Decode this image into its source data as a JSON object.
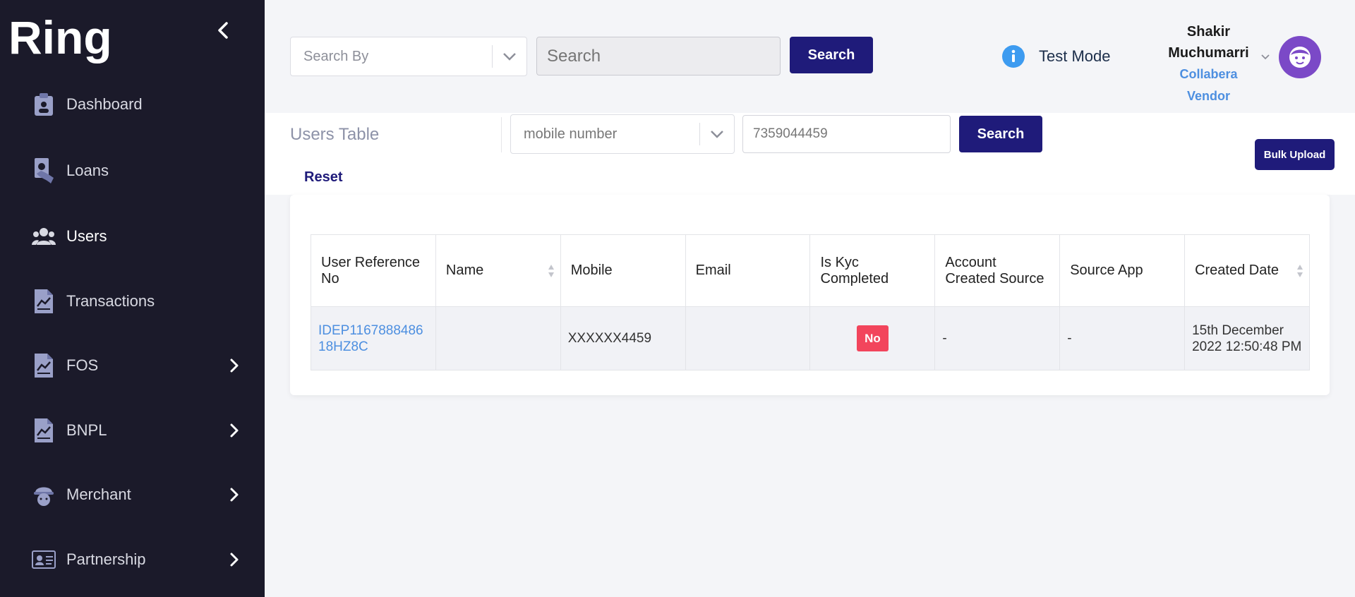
{
  "app": {
    "logo_text": "Ring"
  },
  "sidebar": {
    "items": [
      {
        "label": "Dashboard",
        "icon": "clipboard-icon",
        "has_submenu": false
      },
      {
        "label": "Loans",
        "icon": "money-hand-icon",
        "has_submenu": false
      },
      {
        "label": "Users",
        "icon": "users-icon",
        "has_submenu": false,
        "active": true
      },
      {
        "label": "Transactions",
        "icon": "chart-document-icon",
        "has_submenu": false
      },
      {
        "label": "FOS",
        "icon": "chart-document-icon",
        "has_submenu": true
      },
      {
        "label": "BNPL",
        "icon": "chart-document-icon",
        "has_submenu": true
      },
      {
        "label": "Merchant",
        "icon": "worker-helmet-icon",
        "has_submenu": true
      },
      {
        "label": "Partnership",
        "icon": "id-card-icon",
        "has_submenu": true
      }
    ]
  },
  "header": {
    "search_by": {
      "placeholder": "Search By"
    },
    "search": {
      "placeholder": "Search",
      "value": ""
    },
    "search_button": "Search",
    "test_mode": "Test Mode",
    "user": {
      "first_name": "Shakir",
      "last_name": "Muchumarri",
      "org": "Collabera",
      "role": "Vendor"
    }
  },
  "table_toolbar": {
    "title": "Users Table",
    "filter_field": "mobile number",
    "filter_value": "7359044459",
    "search_button": "Search",
    "bulk_upload_button": "Bulk Upload",
    "reset_label": "Reset"
  },
  "table": {
    "columns": [
      "User Reference No",
      "Name",
      "Mobile",
      "Email",
      "Is Kyc Completed",
      "Account Created Source",
      "Source App",
      "Created Date"
    ],
    "rows": [
      {
        "user_reference_no": "IDEP116788848618HZ8C",
        "name": "",
        "mobile": "XXXXXX4459",
        "email": "",
        "is_kyc_completed": "No",
        "account_created_source": "-",
        "source_app": "-",
        "created_date": "15th December 2022 12:50:48 PM"
      }
    ]
  },
  "colors": {
    "sidebar_bg": "#1b1a2a",
    "primary_button": "#1f1b7a",
    "link": "#4d8fe0",
    "badge_no": "#f2455c",
    "avatar": "#7b49c7"
  }
}
